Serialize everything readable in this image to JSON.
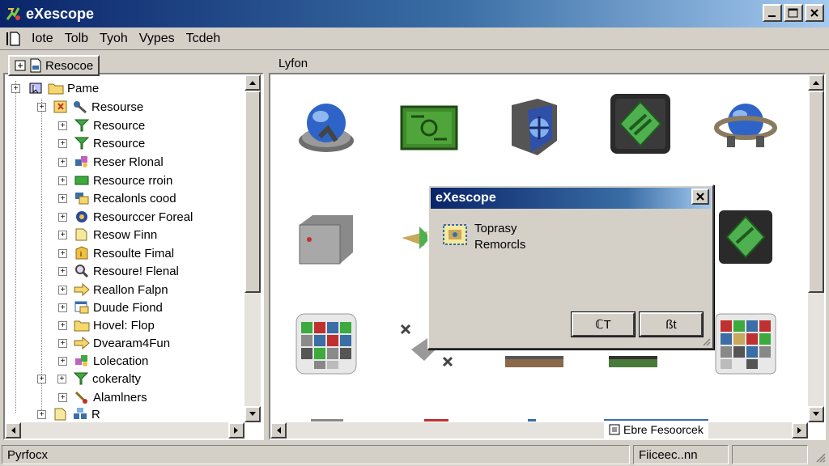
{
  "window": {
    "title": "eXescope"
  },
  "menu": {
    "items": [
      "Iote",
      "Tolb",
      "Tyoh",
      "Vypes",
      "Tcdeh"
    ]
  },
  "left_panel": {
    "tab_label": "Resocoe"
  },
  "tree": {
    "root_label": "Pame",
    "items": [
      {
        "label": "Resourse"
      },
      {
        "label": "Resource"
      },
      {
        "label": "Resource"
      },
      {
        "label": "Reser Rlonal"
      },
      {
        "label": "Resource rroin"
      },
      {
        "label": "Recalonls cood"
      },
      {
        "label": "Resourccer Foreal"
      },
      {
        "label": "Resow Finn"
      },
      {
        "label": "Resoulte Fimal"
      },
      {
        "label": "Resoure! Flenal"
      },
      {
        "label": "Reallon Falpn"
      },
      {
        "label": "Duude Fiond"
      },
      {
        "label": "Hovel: Flop"
      },
      {
        "label": "Dvearam4Fun"
      },
      {
        "label": "Lolecation"
      },
      {
        "label": "cokeralty"
      },
      {
        "label": "Alamlners"
      },
      {
        "label": "R"
      }
    ]
  },
  "right_panel": {
    "header_label": "Lyfon"
  },
  "dialog": {
    "title": "eXescope",
    "line1": "Toprasy",
    "line2": "Remorcls",
    "ok_label": "ℂT",
    "cancel_label": "ßt"
  },
  "bottom_tab": {
    "label": "Ebre Fesoorcek"
  },
  "statusbar": {
    "left_text": "Pyrfocx",
    "right_text": "Fiiceec..nn"
  },
  "colors": {
    "title_bar": "#0a246a",
    "face": "#d4d0c8",
    "selection": "#0a246a"
  }
}
